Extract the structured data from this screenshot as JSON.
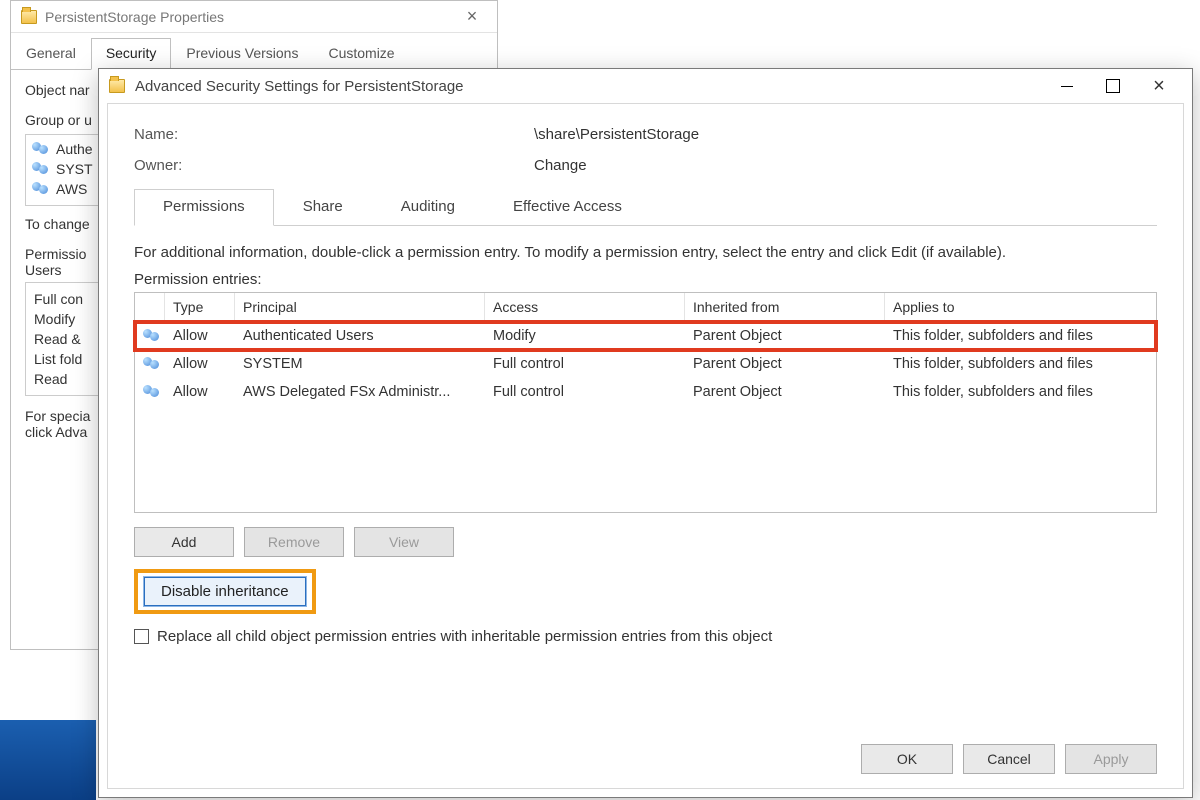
{
  "propsDialog": {
    "title": "PersistentStorage Properties",
    "tabs": [
      "General",
      "Security",
      "Previous Versions",
      "Customize"
    ],
    "activeTab": "Security",
    "objectNameLabel": "Object nar",
    "groupLabel": "Group or u",
    "groups": [
      "Authe",
      "SYST",
      "AWS"
    ],
    "toChange": "To change",
    "permFor": "Permissio",
    "permForUsers": "Users",
    "perms": [
      "Full con",
      "Modify",
      "Read &",
      "List fold",
      "Read"
    ],
    "special1": "For specia",
    "special2": "click Adva"
  },
  "advDialog": {
    "title": "Advanced Security Settings for PersistentStorage",
    "nameLabel": "Name:",
    "nameValue": "\\share\\PersistentStorage",
    "ownerLabel": "Owner:",
    "ownerChange": "Change",
    "tabs": [
      "Permissions",
      "Share",
      "Auditing",
      "Effective Access"
    ],
    "activeTab": "Permissions",
    "hint": "For additional information, double-click a permission entry. To modify a permission entry, select the entry and click Edit (if available).",
    "entriesLabel": "Permission entries:",
    "columns": {
      "type": "Type",
      "principal": "Principal",
      "access": "Access",
      "inherited": "Inherited from",
      "applies": "Applies to"
    },
    "rows": [
      {
        "type": "Allow",
        "principal": "Authenticated Users",
        "access": "Modify",
        "inherited": "Parent Object",
        "applies": "This folder, subfolders and files",
        "highlight": true
      },
      {
        "type": "Allow",
        "principal": "SYSTEM",
        "access": "Full control",
        "inherited": "Parent Object",
        "applies": "This folder, subfolders and files",
        "highlight": false
      },
      {
        "type": "Allow",
        "principal": "AWS Delegated FSx Administr...",
        "access": "Full control",
        "inherited": "Parent Object",
        "applies": "This folder, subfolders and files",
        "highlight": false
      }
    ],
    "buttons": {
      "add": "Add",
      "remove": "Remove",
      "view": "View",
      "disable": "Disable inheritance"
    },
    "replaceLabel": "Replace all child object permission entries with inheritable permission entries from this object",
    "footer": {
      "ok": "OK",
      "cancel": "Cancel",
      "apply": "Apply"
    }
  }
}
